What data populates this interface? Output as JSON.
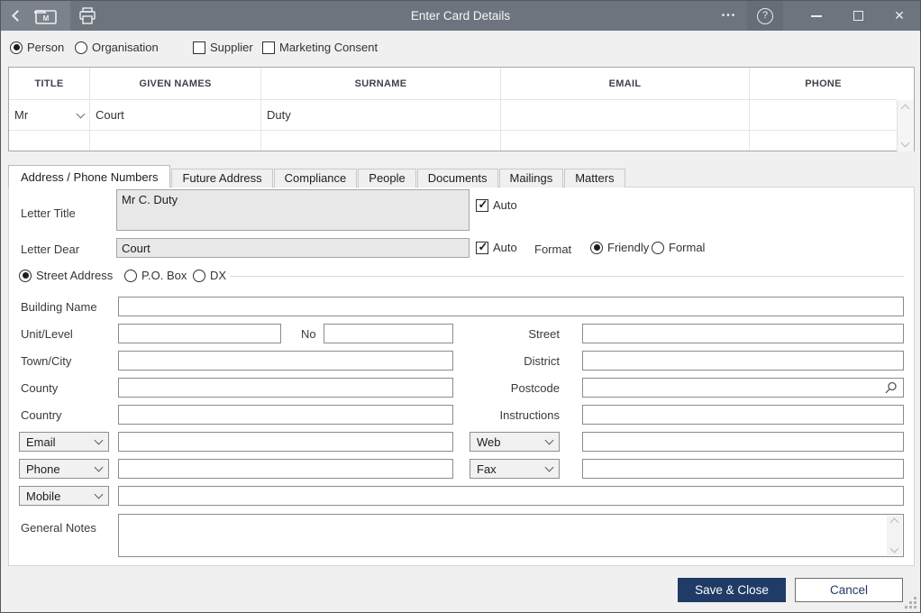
{
  "titlebar": {
    "title": "Enter Card Details",
    "ellipsis": "•••",
    "help": "?",
    "close": "✕"
  },
  "entity_row": {
    "person": "Person",
    "organisation": "Organisation",
    "supplier": "Supplier",
    "marketing_consent": "Marketing Consent",
    "selected_radio": "Person",
    "supplier_checked": false,
    "marketing_checked": false
  },
  "table": {
    "headers": [
      "TITLE",
      "GIVEN NAMES",
      "SURNAME",
      "EMAIL",
      "PHONE"
    ],
    "rows": [
      {
        "title": "Mr",
        "given_names": "Court",
        "surname": "Duty",
        "email": "",
        "phone": ""
      },
      {
        "title": "",
        "given_names": "",
        "surname": "",
        "email": "",
        "phone": ""
      }
    ]
  },
  "tabs": [
    {
      "label": "Address / Phone Numbers",
      "active": true
    },
    {
      "label": "Future Address",
      "active": false
    },
    {
      "label": "Compliance",
      "active": false
    },
    {
      "label": "People",
      "active": false
    },
    {
      "label": "Documents",
      "active": false
    },
    {
      "label": "Mailings",
      "active": false
    },
    {
      "label": "Matters",
      "active": false
    }
  ],
  "form": {
    "letter_title": {
      "label": "Letter Title",
      "value": "Mr C. Duty",
      "auto_label": "Auto",
      "auto_checked": true
    },
    "letter_dear": {
      "label": "Letter Dear",
      "value": "Court",
      "auto_label": "Auto",
      "auto_checked": true,
      "format_label": "Format",
      "format_friendly": "Friendly",
      "format_formal": "Formal",
      "format_selected": "Friendly"
    },
    "address_type": {
      "street": "Street Address",
      "po_box": "P.O. Box",
      "dx": "DX",
      "selected": "Street Address"
    },
    "labels": {
      "building_name": "Building Name",
      "unit_level": "Unit/Level",
      "no": "No",
      "street": "Street",
      "town_city": "Town/City",
      "district": "District",
      "county": "County",
      "postcode": "Postcode",
      "country": "Country",
      "instructions": "Instructions",
      "general_notes": "General Notes"
    },
    "values": {
      "building_name": "",
      "unit_level": "",
      "no": "",
      "street": "",
      "town_city": "",
      "district": "",
      "county": "",
      "postcode": "",
      "country": "",
      "instructions": "",
      "email": "",
      "web": "",
      "phone": "",
      "fax": "",
      "mobile": "",
      "general_notes": ""
    },
    "contact_selects": {
      "email": "Email",
      "web": "Web",
      "phone": "Phone",
      "fax": "Fax",
      "mobile": "Mobile"
    }
  },
  "buttons": {
    "save_close": "Save & Close",
    "cancel": "Cancel"
  },
  "colors": {
    "titlebar": "#6d747d",
    "accent_button": "#1f3b66",
    "window_bg": "#f0f0f0"
  }
}
